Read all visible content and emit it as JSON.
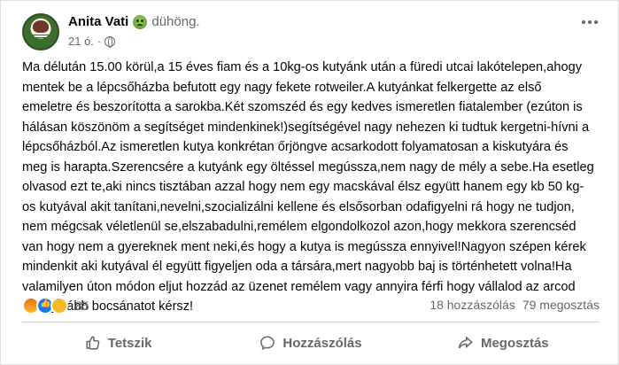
{
  "post": {
    "author": "Anita Vati",
    "feeling_label": "dühöng.",
    "timestamp": "21 ó.",
    "audience_separator": "·",
    "text": "Ma délután 15.00 körül,a 15 éves fiam és a 10kg-os kutyánk után a füredi utcai lakótelepen,ahogy\nmentek be a lépcsőházba  befutott egy nagy fekete rotweiler.A kutyánkat felkergette az első\nemeletre és beszorította a sarokba.Két szomszéd és egy kedves ismeretlen fiatalember (ezúton is\nhálásan köszönöm a segítséget mindenkinek!)segítségével nagy nehezen ki tudtuk kergetni-hívni a\nlépcsőházból.Az ismeretlen kutya konkrétan őrjöngve acsarkodott folyamatosan a kiskutyára és\nmeg is harapta.Szerencsére a kutyánk egy öltéssel megússza,nem nagy de mély a sebe.Ha esetleg\nolvasod ezt te,aki nincs tisztában azzal hogy nem egy macskával élsz együtt hanem egy kb 50 kg-\nos kutyával akit tanítani,nevelni,szocializálni kellene és elsősorban odafigyelni rá hogy ne tudjon,\nnem mégcsak véletlenül se,elszabadulni,remélem elgondolkozol azon,hogy mekkora szerencséd\nvan hogy nem a gyereknek ment neki,és hogy a kutya is megússza ennyivel!Nagyon szépen kérek\nmindenkit aki kutyával él együtt figyeljen oda a társára,mert nagyobb baj is történhetett volna!Ha\nvalamilyen úton módon eljut hozzád az üzenet remélem vagy annyira férfi hogy vállalod az arcod\nés legalább bocsánatot kérsz!"
  },
  "reactions": {
    "icons": [
      "angry-reaction-icon",
      "like-reaction-icon",
      "sad-reaction-icon"
    ],
    "count": "85"
  },
  "stats": {
    "comments": "18 hozzászólás",
    "shares": "79 megosztás"
  },
  "actions": {
    "like": "Tetszik",
    "comment": "Hozzászólás",
    "share": "Megosztás"
  },
  "colors": {
    "secondary_text": "#65676b",
    "like_blue": "#1877f2",
    "card_bg": "#ffffff"
  }
}
